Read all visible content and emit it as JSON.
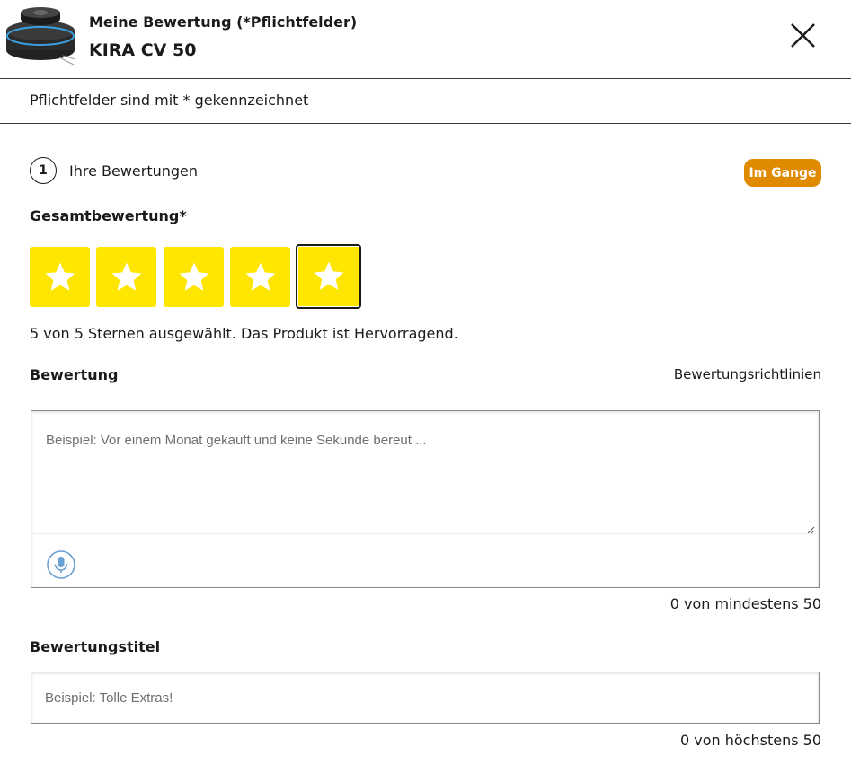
{
  "header": {
    "subtitle": "Meine Bewertung (*Pflichtfelder)",
    "product_name": "KIRA CV 50",
    "close_icon": "close-icon"
  },
  "required_note": "Pflichtfelder sind mit * gekennzeichnet",
  "step": {
    "number": "1",
    "label": "Ihre Bewertungen",
    "status": "Im Gange",
    "status_color": "#e08a00"
  },
  "overall": {
    "label": "Gesamtbewertung*",
    "stars_total": 5,
    "stars_selected": 5,
    "star_color": "#ffe600",
    "rating_text": "5 von 5 Sternen ausgewählt. Das Produkt ist Hervorragend."
  },
  "review": {
    "label": "Bewertung",
    "guidelines_link": "Bewertungsrichtlinien",
    "placeholder": "Beispiel: Vor einem Monat gekauft und keine Sekunde bereut ...",
    "mic_icon": "microphone-icon",
    "counter": "0 von mindestens 50"
  },
  "title": {
    "label": "Bewertungstitel",
    "placeholder": "Beispiel: Tolle Extras!",
    "counter": "0 von höchstens 50"
  }
}
